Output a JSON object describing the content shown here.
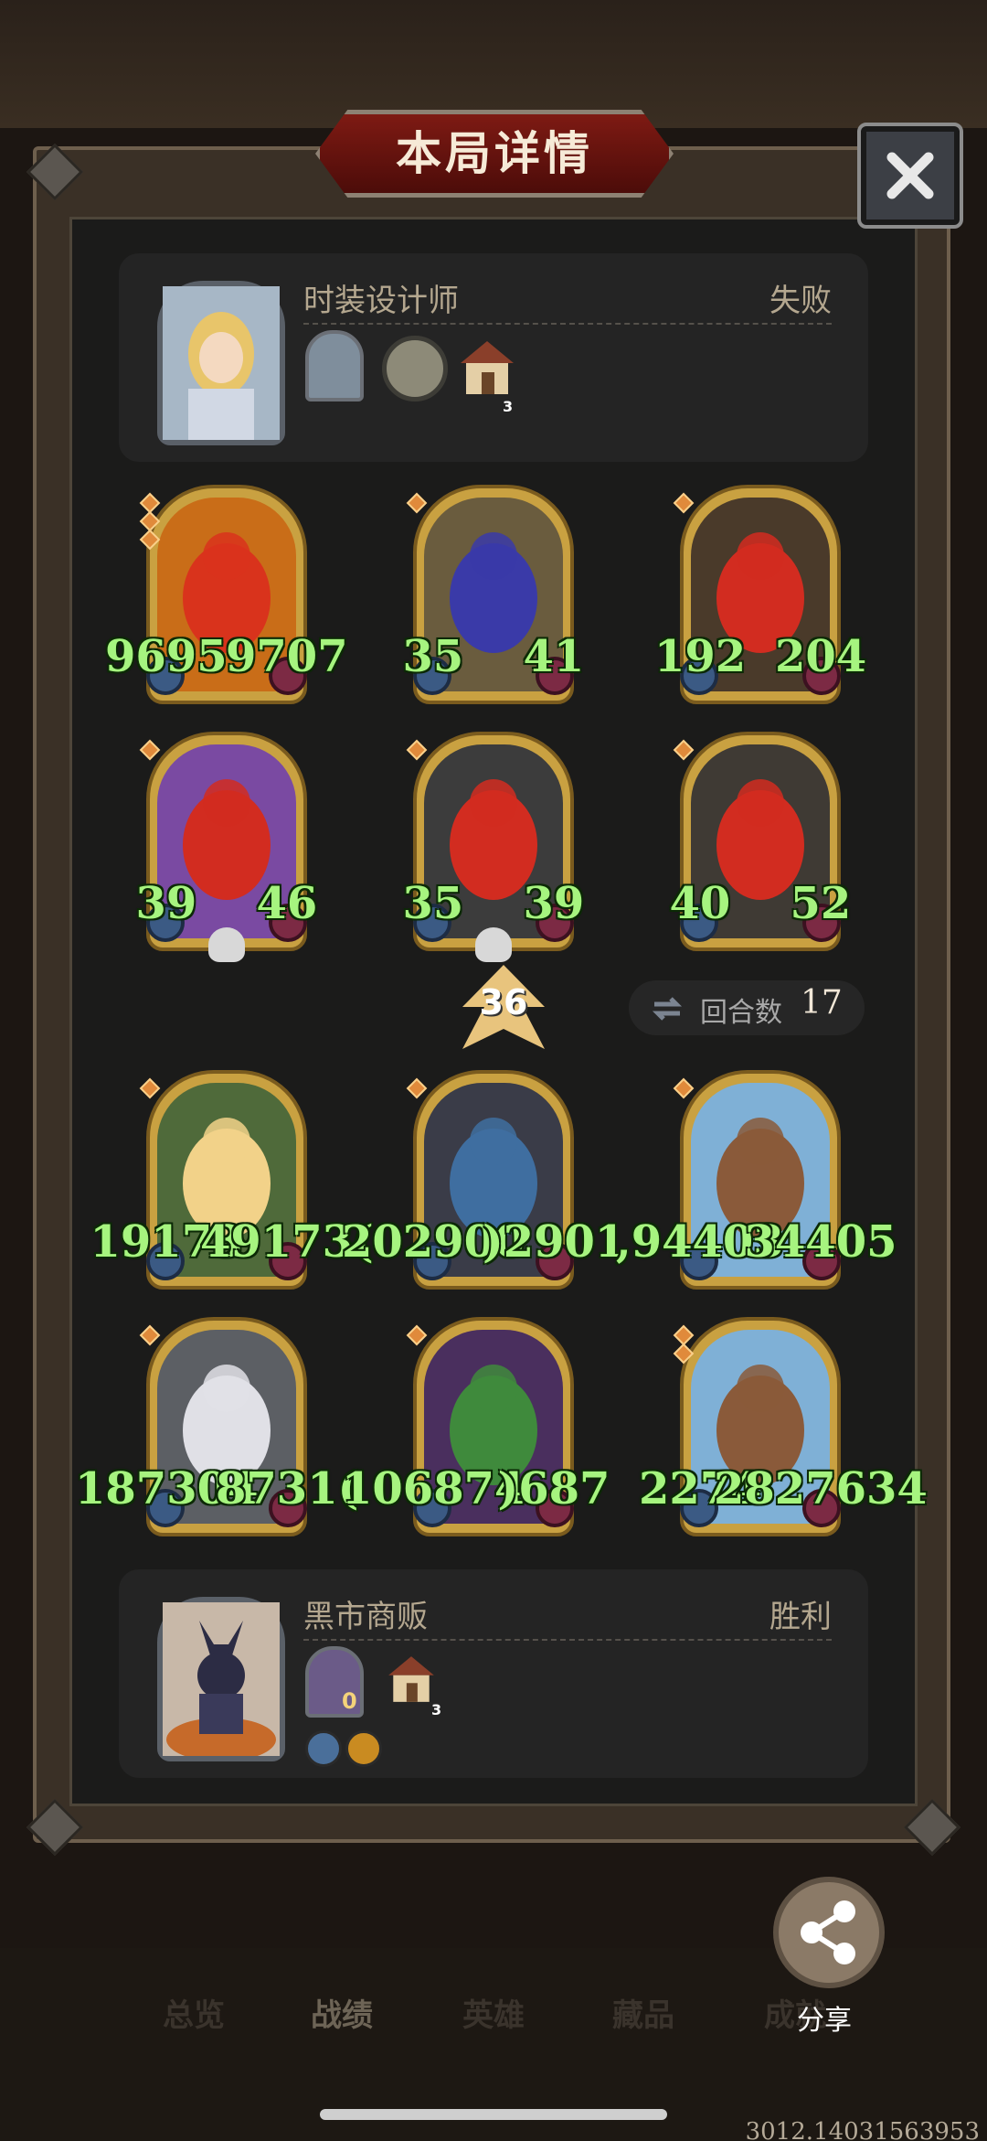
{
  "header": {
    "title": "本局详情",
    "close_icon": "close-icon"
  },
  "player_top": {
    "name": "时装设计师",
    "result": "失败",
    "house_count": "3"
  },
  "board_top": {
    "units": [
      {
        "attack": "9695",
        "health": "9707"
      },
      {
        "attack": "35",
        "health": "41"
      },
      {
        "attack": "192",
        "health": "204"
      },
      {
        "attack": "39",
        "health": "46"
      },
      {
        "attack": "35",
        "health": "39"
      },
      {
        "attack": "40",
        "health": "52"
      }
    ]
  },
  "middle": {
    "level": "36",
    "round_label": "回合数",
    "round_value": "17"
  },
  "board_bottom": {
    "units": [
      {
        "attack": "19173",
        "health": "49173("
      },
      {
        "attack": "202900",
        "health": ")2901"
      },
      {
        "attack": ",94403",
        "health": "34405"
      },
      {
        "attack": "187304",
        "health": "8731("
      },
      {
        "attack": "106874",
        "health": ")687"
      },
      {
        "attack": "2274",
        "health": "2827634"
      }
    ]
  },
  "player_bottom": {
    "name": "黑市商贩",
    "result": "胜利",
    "coin_value": "0",
    "house_count": "3"
  },
  "tabs": [
    "总览",
    "战绩",
    "英雄",
    "藏品",
    "成就"
  ],
  "active_tab": "战绩",
  "share": {
    "label": "分享"
  },
  "build_id": "3012.14031563953"
}
